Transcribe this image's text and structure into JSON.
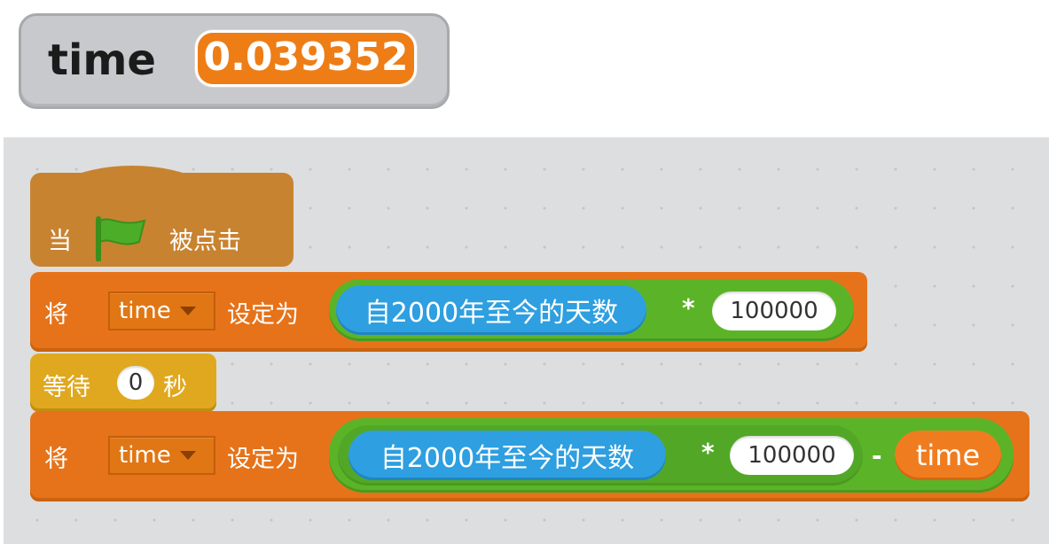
{
  "monitor": {
    "label": "time",
    "value": "0.039352"
  },
  "script": {
    "hat": {
      "prefix": "当",
      "icon": "green-flag-icon",
      "suffix": "被点击"
    },
    "set1": {
      "keyword": "将",
      "variable": "time",
      "action": "设定为",
      "reporter": "自2000年至今的天数",
      "operator": "*",
      "number": "100000"
    },
    "wait": {
      "keyword": "等待",
      "seconds": "0",
      "unit": "秒"
    },
    "set2": {
      "keyword": "将",
      "variable": "time",
      "action": "设定为",
      "reporter": "自2000年至今的天数",
      "operator": "*",
      "number": "100000",
      "minus": "-",
      "variable_reporter": "time"
    }
  },
  "colors": {
    "events": "#c88330",
    "data": "#e6731a",
    "control": "#e0a81f",
    "operators": "#5bb428",
    "sensing": "#2e9fe0"
  }
}
